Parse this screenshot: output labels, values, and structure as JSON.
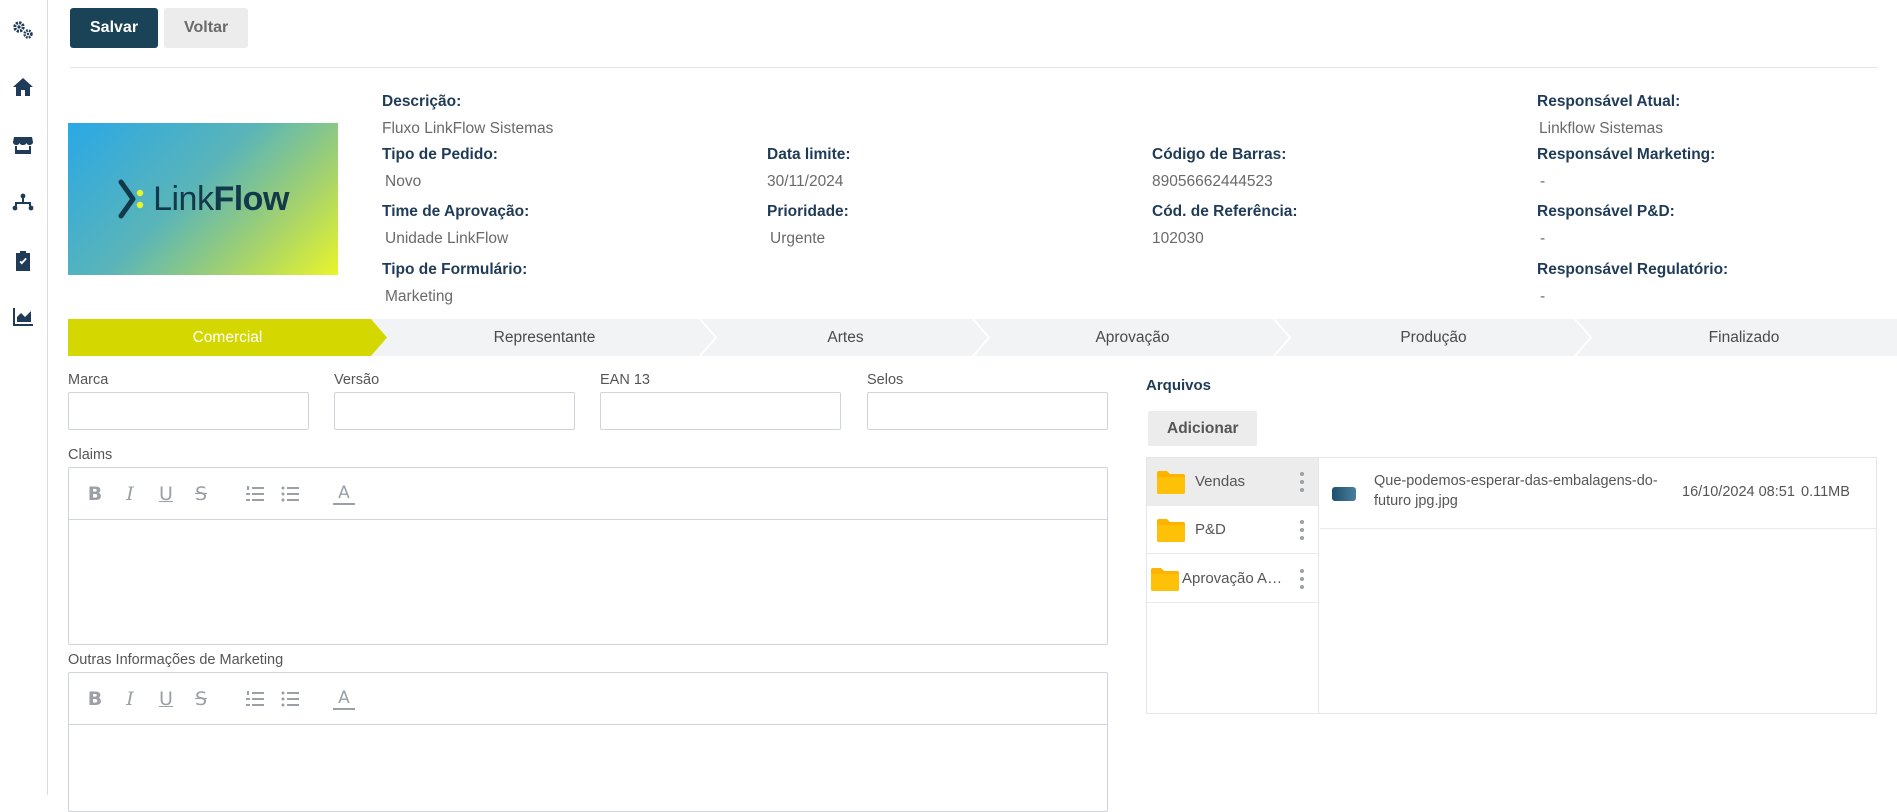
{
  "sidebar": {
    "items": [
      {
        "icon": "gears-icon"
      },
      {
        "icon": "home-icon"
      },
      {
        "icon": "store-icon"
      },
      {
        "icon": "workflow-icon"
      },
      {
        "icon": "clipboard-check-icon"
      },
      {
        "icon": "area-chart-icon"
      }
    ],
    "active_index": 3
  },
  "toolbar": {
    "save_label": "Salvar",
    "back_label": "Voltar"
  },
  "logo": {
    "text_light": "Link",
    "text_bold": "Flow",
    "colors": [
      "#2aa8e6",
      "#e8f52b"
    ]
  },
  "info": {
    "descricao": {
      "label": "Descrição:",
      "value": "Fluxo LinkFlow Sistemas"
    },
    "tipo_pedido": {
      "label": "Tipo de Pedido:",
      "value": "Novo"
    },
    "time_aprovacao": {
      "label": "Time de Aprovação:",
      "value": "Unidade LinkFlow"
    },
    "tipo_formulario": {
      "label": "Tipo de Formulário:",
      "value": "Marketing"
    },
    "data_limite": {
      "label": "Data limite:",
      "value": "30/11/2024"
    },
    "prioridade": {
      "label": "Prioridade:",
      "value": "Urgente"
    },
    "codigo_barras": {
      "label": "Código de Barras:",
      "value": "89056662444523"
    },
    "cod_referencia": {
      "label": "Cód. de Referência:",
      "value": "102030"
    },
    "resp_atual": {
      "label": "Responsável Atual:",
      "value": "Linkflow Sistemas"
    },
    "resp_marketing": {
      "label": "Responsável Marketing:",
      "value": "-"
    },
    "resp_pd": {
      "label": "Responsável P&D:",
      "value": "-"
    },
    "resp_regulatorio": {
      "label": "Responsável Regulatório:",
      "value": "-"
    }
  },
  "stepper": {
    "active_color": "#d4d800",
    "steps": [
      {
        "label": "Comercial",
        "active": true
      },
      {
        "label": "Representante"
      },
      {
        "label": "Artes"
      },
      {
        "label": "Aprovação"
      },
      {
        "label": "Produção"
      },
      {
        "label": "Finalizado"
      }
    ]
  },
  "form": {
    "marca": {
      "label": "Marca",
      "value": ""
    },
    "versao": {
      "label": "Versão",
      "value": ""
    },
    "ean13": {
      "label": "EAN 13",
      "value": ""
    },
    "selos": {
      "label": "Selos",
      "value": ""
    },
    "claims": {
      "label": "Claims"
    },
    "outras_info": {
      "label": "Outras Informações de Marketing"
    },
    "editor_tools": {
      "bold": "B",
      "italic": "I",
      "underline": "U",
      "strike": "S",
      "font_color": "A"
    }
  },
  "files": {
    "title": "Arquivos",
    "add_label": "Adicionar",
    "folder_color": "#ffb300",
    "folders": [
      {
        "name": "Vendas",
        "selected": true
      },
      {
        "name": "P&D"
      },
      {
        "name": "Aprovação Ad..."
      }
    ],
    "items": [
      {
        "name": "Que-podemos-esperar-das-embalagens-do-futuro jpg.jpg",
        "date": "16/10/2024 08:51",
        "size": "0.11MB"
      }
    ]
  }
}
